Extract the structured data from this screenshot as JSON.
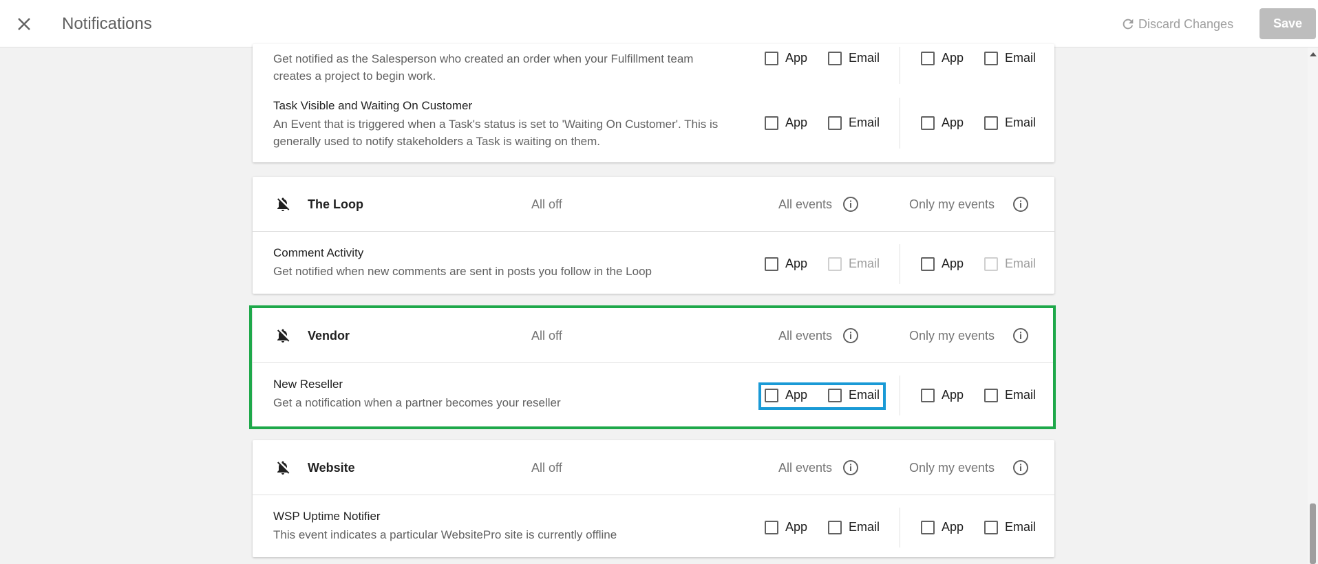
{
  "header": {
    "title": "Notifications",
    "discard_label": "Discard Changes",
    "save_label": "Save",
    "close_icon": "close-icon",
    "discard_icon": "refresh-icon"
  },
  "option_labels": {
    "app": "App",
    "email": "Email"
  },
  "categories": [
    {
      "name": "",
      "events": [
        {
          "title": "",
          "description": "Get notified as the Salesperson who created an order when your Fulfillment team creates a project to begin work."
        },
        {
          "title": "Task Visible and Waiting On Customer",
          "description": "An Event that is triggered when a Task's status is set to 'Waiting On Customer'. This is generally used to notify stakeholders a Task is waiting on them."
        }
      ]
    },
    {
      "name": "The Loop",
      "status": "All off",
      "all_events_label": "All events",
      "only_my_events_label": "Only my events",
      "events": [
        {
          "title": "Comment Activity",
          "description": "Get notified when new comments are sent in posts you follow in the Loop"
        }
      ]
    },
    {
      "name": "Vendor",
      "status": "All off",
      "all_events_label": "All events",
      "only_my_events_label": "Only my events",
      "events": [
        {
          "title": "New Reseller",
          "description": "Get a notification when a partner becomes your reseller"
        }
      ]
    },
    {
      "name": "Website",
      "status": "All off",
      "all_events_label": "All events",
      "only_my_events_label": "Only my events",
      "events": [
        {
          "title": "WSP Uptime Notifier",
          "description": "This event indicates a particular WebsitePro site is currently offline"
        }
      ]
    }
  ],
  "colors": {
    "highlight_section": "#1ea84a",
    "highlight_options": "#1a9ad6",
    "save_disabled": "#bdbdbd"
  }
}
